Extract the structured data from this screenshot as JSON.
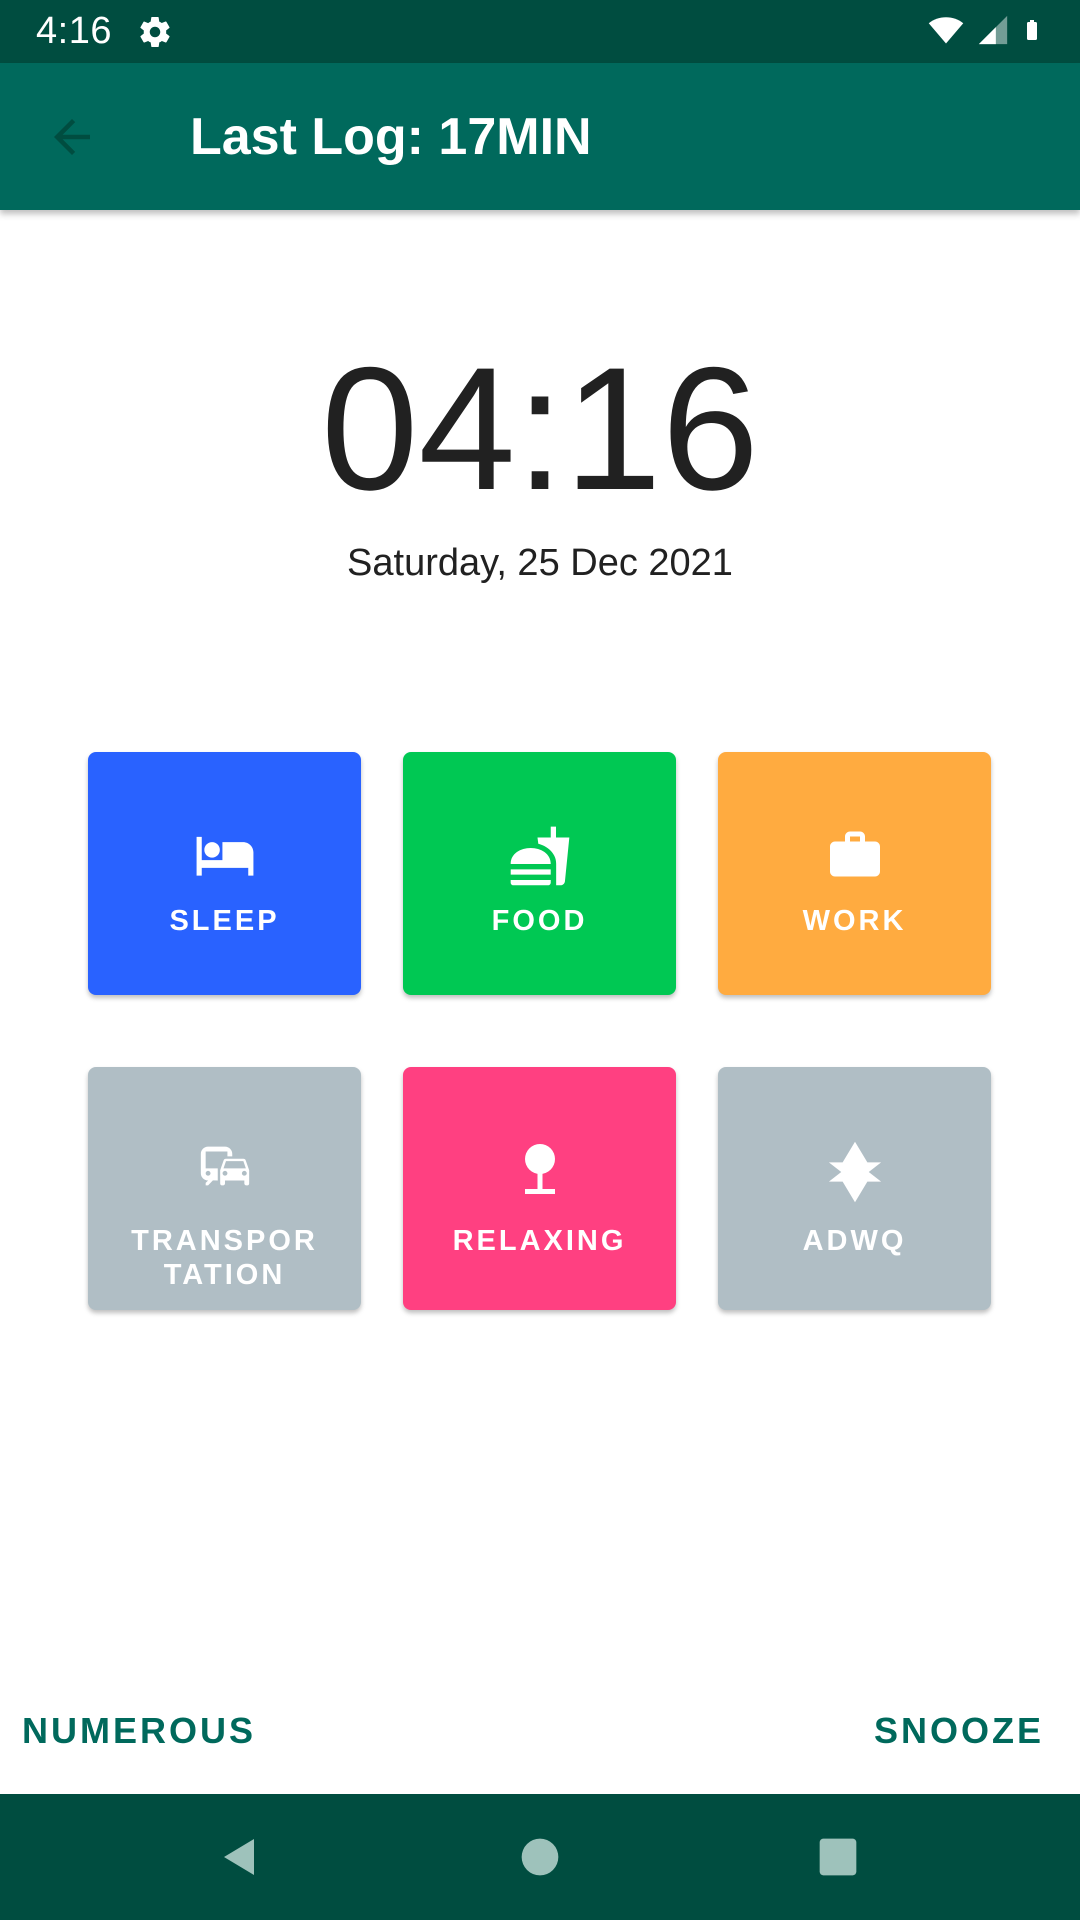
{
  "status_bar": {
    "time": "4:16",
    "icons": [
      "settings-icon",
      "wifi-icon",
      "signal-icon",
      "battery-icon"
    ]
  },
  "app_bar": {
    "title": "Last Log: 17MIN",
    "back_icon": "arrow-back-icon"
  },
  "clock": {
    "time": "04:16",
    "date": "Saturday, 25 Dec 2021"
  },
  "activities": [
    {
      "label": "SLEEP",
      "icon": "bed-icon",
      "color": "#2962ff"
    },
    {
      "label": "FOOD",
      "icon": "fastfood-icon",
      "color": "#00c853"
    },
    {
      "label": "WORK",
      "icon": "briefcase-icon",
      "color": "#ffab40"
    },
    {
      "label": "TRANSPORTATION",
      "line1": "TRANSPOR",
      "line2": "TATION",
      "icon": "commute-icon",
      "color": "#b0bec5"
    },
    {
      "label": "RELAXING",
      "icon": "tree-icon",
      "color": "#ff4081"
    },
    {
      "label": "ADWQ",
      "icon": "star-of-david-icon",
      "color": "#b0bec5"
    }
  ],
  "actions": {
    "left": "NUMEROUS",
    "right": "SNOOZE"
  },
  "colors": {
    "status_bar": "#004d40",
    "app_bar": "#00695c",
    "accent": "#00695c"
  }
}
